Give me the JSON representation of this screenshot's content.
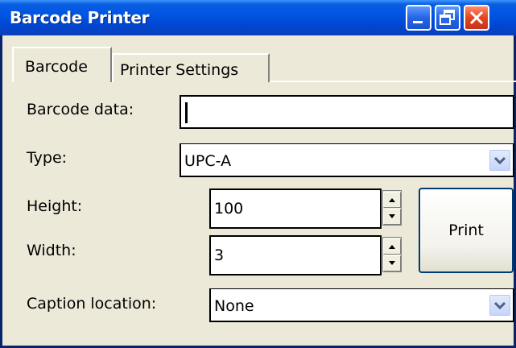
{
  "window": {
    "title": "Barcode Printer"
  },
  "titlebar_buttons": {
    "minimize_icon": "minimize-icon",
    "restore_icon": "restore-icon",
    "close_icon": "close-icon"
  },
  "tabs": [
    {
      "label": "Barcode",
      "active": true
    },
    {
      "label": "Printer Settings",
      "active": false
    }
  ],
  "form": {
    "barcode_data_label": "Barcode data:",
    "barcode_data_value": "",
    "type_label": "Type:",
    "type_value": "UPC-A",
    "height_label": "Height:",
    "height_value": "100",
    "width_label": "Width:",
    "width_value": "3",
    "caption_label": "Caption location:",
    "caption_value": "None"
  },
  "actions": {
    "print_label": "Print"
  },
  "colors": {
    "titlebar": "#0055e5",
    "close_button": "#e5431d",
    "window_bg": "#ece9d8"
  }
}
